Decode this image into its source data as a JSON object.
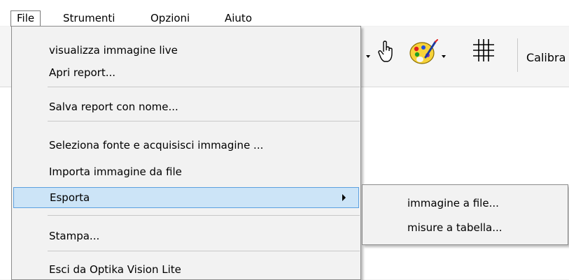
{
  "menubar": {
    "items": [
      {
        "label": "File"
      },
      {
        "label": "Strumenti"
      },
      {
        "label": "Opzioni"
      },
      {
        "label": "Aiuto"
      }
    ]
  },
  "toolbar": {
    "calibra_label": "Calibra",
    "icons": [
      "dropdown-arrow-icon",
      "hand-pointer-icon",
      "palette-icon",
      "grid-icon"
    ]
  },
  "file_menu": {
    "items": [
      {
        "label": "visualizza immagine live"
      },
      {
        "label": "Apri report..."
      },
      {
        "label": "Salva report con nome..."
      },
      {
        "label": "Seleziona fonte e acquisisci immagine ..."
      },
      {
        "label": "Importa immagine da file"
      },
      {
        "label": "Esporta"
      },
      {
        "label": "Stampa..."
      },
      {
        "label": "Esci da Optika Vision Lite"
      }
    ]
  },
  "export_submenu": {
    "items": [
      {
        "label": "immagine a file..."
      },
      {
        "label": "misure a tabella..."
      }
    ]
  },
  "colors": {
    "highlight_bg": "#cce4f7",
    "highlight_border": "#5ba0e0",
    "menu_bg": "#f2f2f2"
  }
}
